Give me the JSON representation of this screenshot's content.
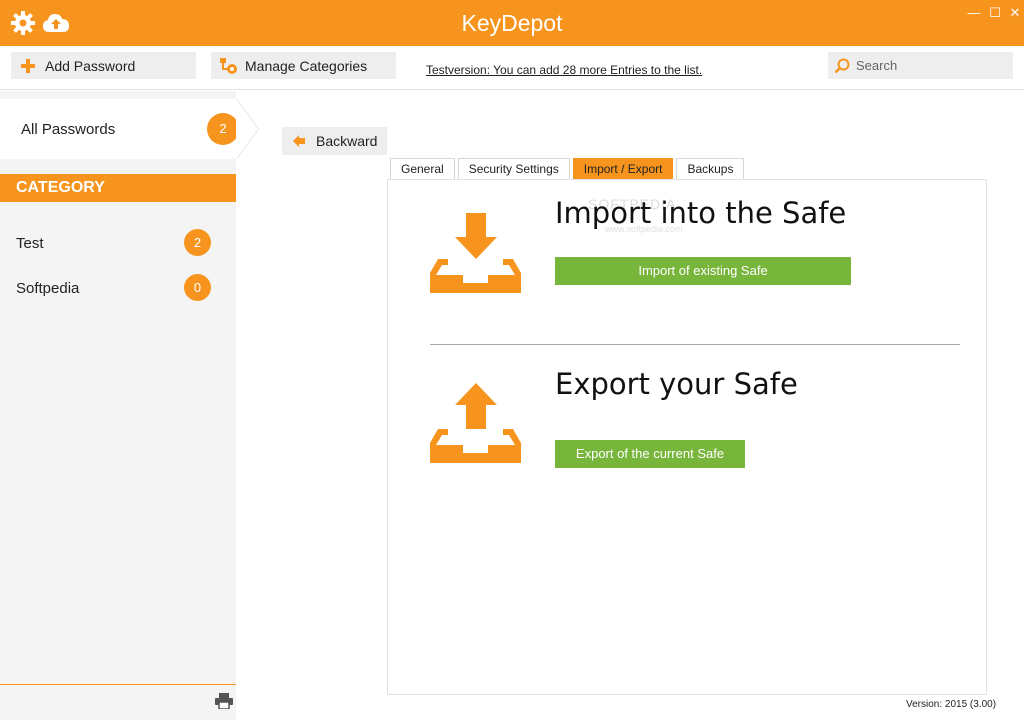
{
  "window": {
    "title": "KeyDepot",
    "minimize": "—",
    "maximize": "☐",
    "close": "✕"
  },
  "icons": {
    "settings": "gear-icon",
    "cloud": "cloud-upload-icon",
    "add": "plus-icon",
    "categories": "manage-categories-icon",
    "search": "search-icon",
    "back": "arrow-left-icon",
    "import": "tray-import-icon",
    "export": "tray-export-icon",
    "print": "printer-icon"
  },
  "colors": {
    "accent": "#f7941d",
    "button_green": "#77b53b"
  },
  "toolbar": {
    "add_password": "Add Password",
    "manage_categories": "Manage Categories",
    "notice": "Testversion: You can add 28 more Entries to the list.",
    "search_placeholder": "Search"
  },
  "sidebar": {
    "all_passwords": {
      "label": "All Passwords",
      "count": "2"
    },
    "category_header": "CATEGORY",
    "categories": [
      {
        "label": "Test",
        "count": "2"
      },
      {
        "label": "Softpedia",
        "count": "0"
      }
    ]
  },
  "main": {
    "back_label": "Backward",
    "tabs": [
      {
        "label": "General",
        "active": false
      },
      {
        "label": "Security Settings",
        "active": false
      },
      {
        "label": "Import / Export",
        "active": true
      },
      {
        "label": "Backups",
        "active": false
      }
    ],
    "import": {
      "title": "Import into the Safe",
      "button": "Import of existing Safe"
    },
    "export": {
      "title": "Export your Safe",
      "button": "Export of the current Safe"
    },
    "watermark": "SOFTPEDIA",
    "watermark_url": "www.softpedia.com"
  },
  "footer": {
    "version": "Version:  2015 (3.00)"
  }
}
